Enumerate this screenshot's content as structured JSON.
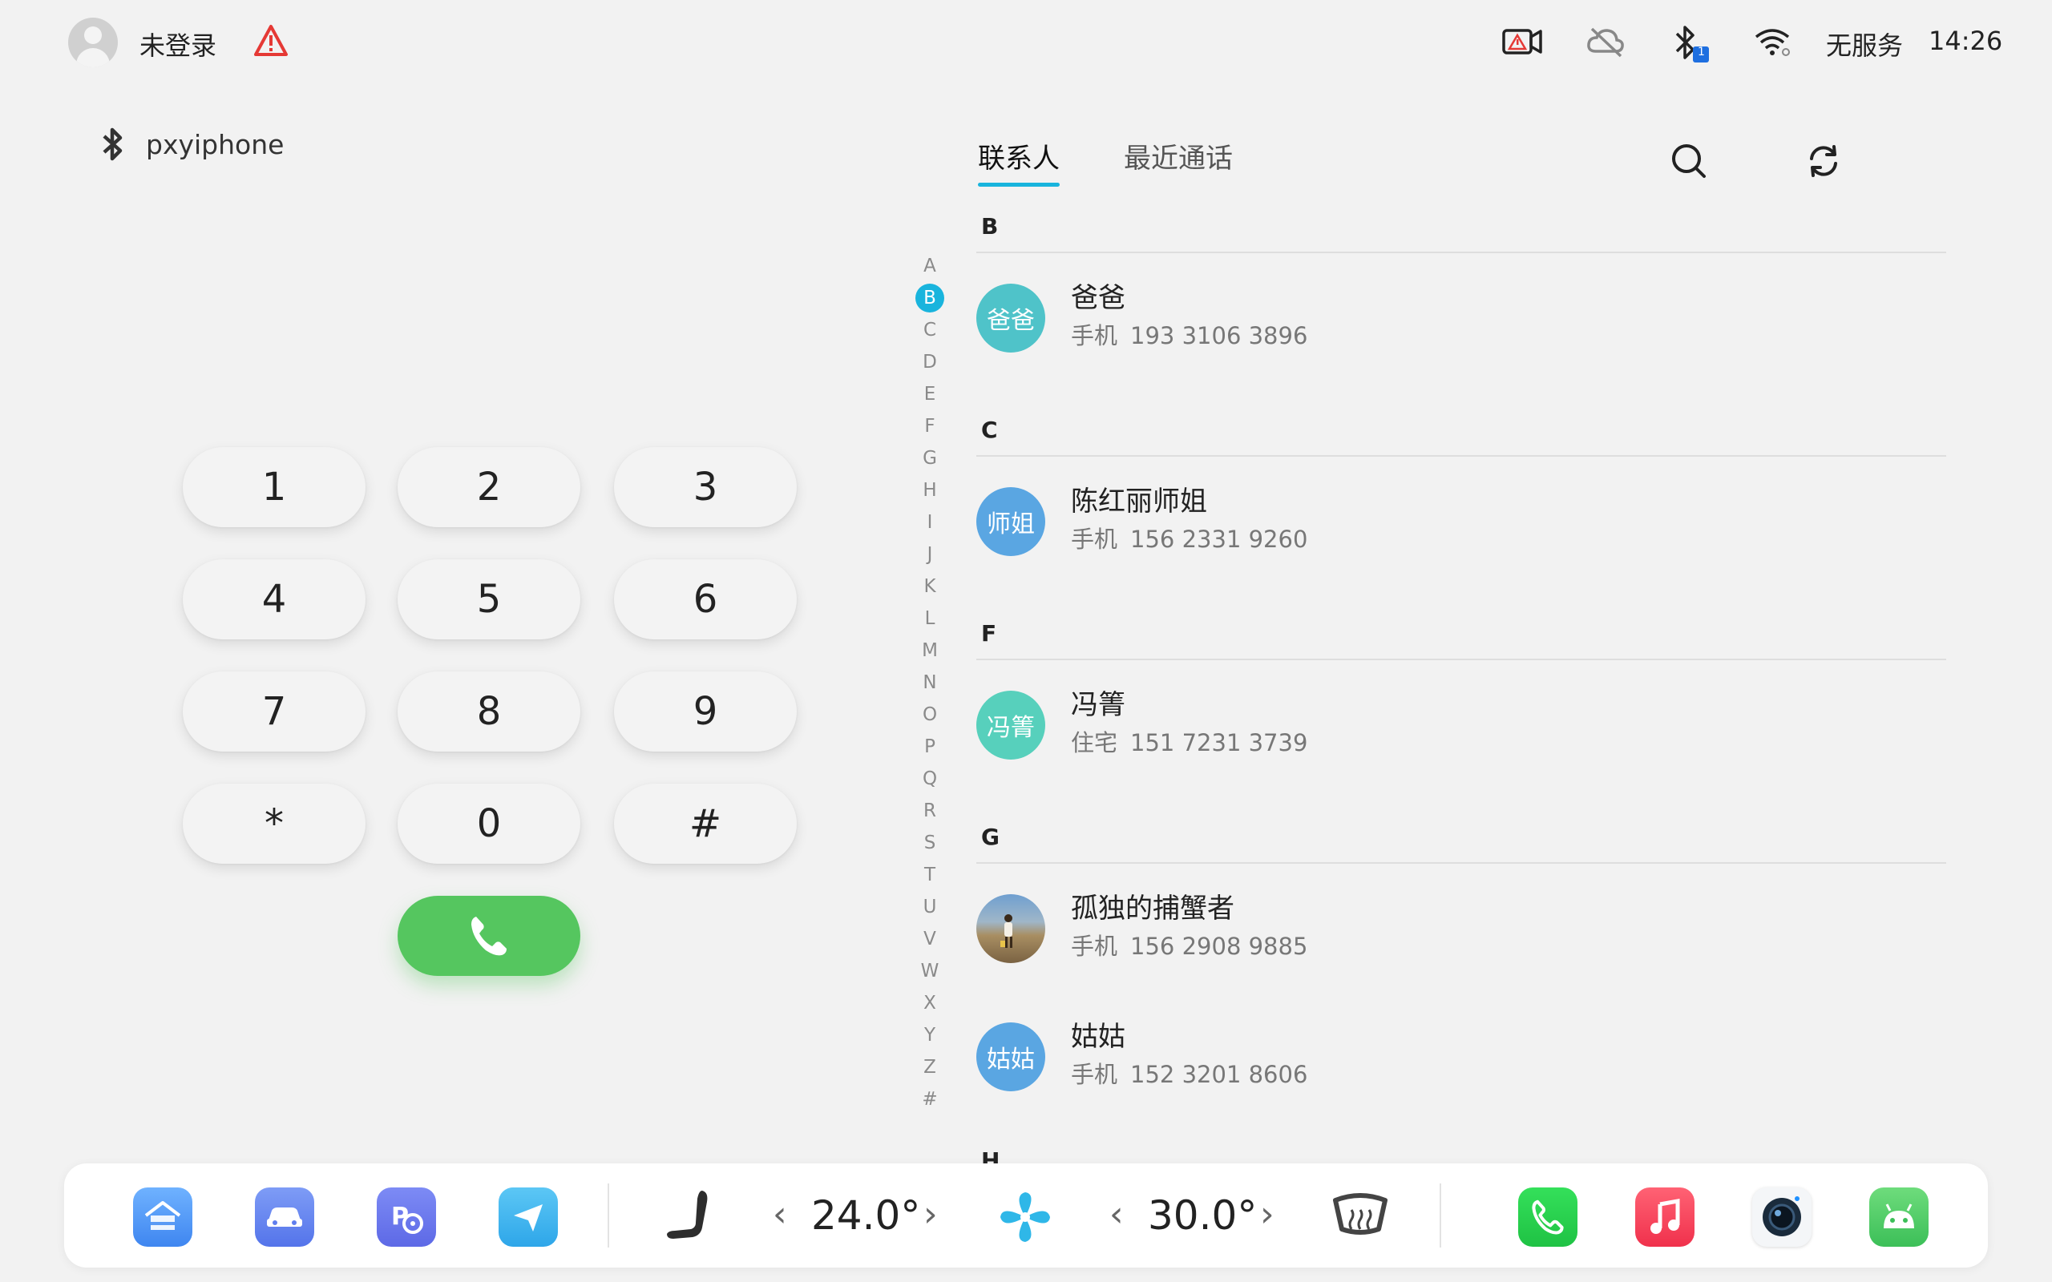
{
  "status_bar": {
    "login_label": "未登录",
    "service_label": "无服务",
    "time": "14:26",
    "bluetooth_badge": "1",
    "icons": [
      "user-avatar-icon",
      "warning-icon",
      "dashcam-warning-icon",
      "cloud-off-icon",
      "bluetooth-icon",
      "wifi-icon"
    ]
  },
  "bluetooth_device": {
    "name": "pxyiphone"
  },
  "dialpad": {
    "keys": [
      "1",
      "2",
      "3",
      "4",
      "5",
      "6",
      "7",
      "8",
      "9",
      "*",
      "0",
      "#"
    ]
  },
  "tabs": {
    "contacts": "联系人",
    "recent": "最近通话"
  },
  "alphabet": [
    "A",
    "B",
    "C",
    "D",
    "E",
    "F",
    "G",
    "H",
    "I",
    "J",
    "K",
    "L",
    "M",
    "N",
    "O",
    "P",
    "Q",
    "R",
    "S",
    "T",
    "U",
    "V",
    "W",
    "X",
    "Y",
    "Z",
    "#"
  ],
  "alphabet_active": "B",
  "contacts": {
    "sections": [
      {
        "letter": "B"
      },
      {
        "letter": "C"
      },
      {
        "letter": "F"
      },
      {
        "letter": "G"
      }
    ],
    "items": [
      {
        "avatar": "爸爸",
        "name": "爸爸",
        "label": "手机",
        "number": "193 3106 3896",
        "color": "#4fc3c9"
      },
      {
        "avatar": "师姐",
        "name": "陈红丽师姐",
        "label": "手机",
        "number": "156 2331 9260",
        "color": "#5aa6e2"
      },
      {
        "avatar": "冯箐",
        "name": "冯箐",
        "label": "住宅",
        "number": "151 7231 3739",
        "color": "#57d0bc"
      },
      {
        "avatar": "",
        "name": "孤独的捕蟹者",
        "label": "手机",
        "number": "156 2908 9885",
        "color": "#8b7a5e"
      },
      {
        "avatar": "姑姑",
        "name": "姑姑",
        "label": "手机",
        "number": "152 3201 8606",
        "color": "#5aa6e2"
      }
    ],
    "next_section_partial": "H"
  },
  "dock": {
    "left_temp": "24.0°",
    "right_temp": "30.0°",
    "apps": [
      "home-icon",
      "car-icon",
      "parking-icon",
      "navigation-icon",
      "seat-icon",
      "fan-icon",
      "rear-defrost-icon",
      "phone-app-icon",
      "music-app-icon",
      "camera-app-icon",
      "android-app-icon"
    ],
    "colors": {
      "accent": "#19b4dd",
      "call": "#55c65f"
    }
  }
}
